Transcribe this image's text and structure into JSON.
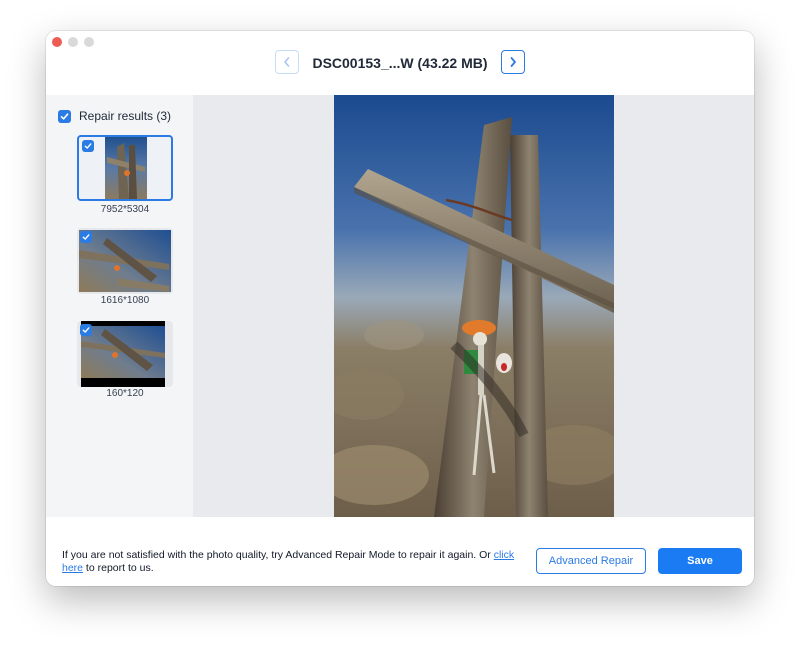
{
  "window": {
    "title": "DSC00153_...W (43.22 MB)"
  },
  "sidebar": {
    "results_label": "Repair results (3)",
    "items": [
      {
        "size": "7952*5304",
        "checked": true,
        "selected": true
      },
      {
        "size": "1616*1080",
        "checked": true,
        "selected": false
      },
      {
        "size": "160*120",
        "checked": true,
        "selected": false
      }
    ]
  },
  "footer": {
    "message_start": "If you are not satisfied with the photo quality, try Advanced Repair Mode to repair it again. Or ",
    "link_text_1": "click",
    "link_text_2": "here",
    "message_end": " to report to us.",
    "advanced_label": "Advanced Repair",
    "save_label": "Save"
  },
  "colors": {
    "accent": "#2b7be4",
    "save": "#1a7bf2",
    "sky": "#1f4f93"
  },
  "icons": [
    "chevron-left-icon",
    "chevron-right-icon",
    "checkbox-icon"
  ]
}
